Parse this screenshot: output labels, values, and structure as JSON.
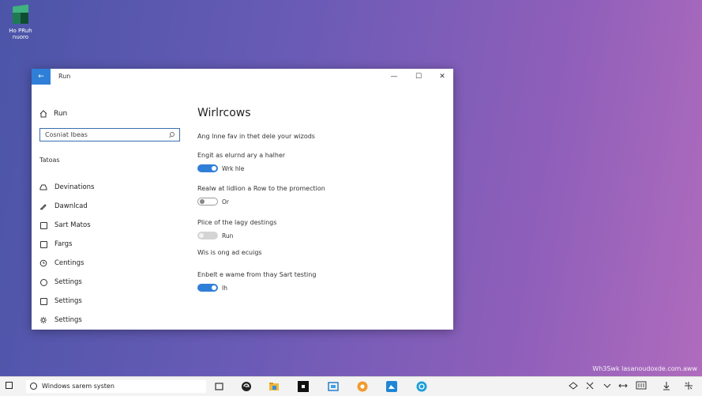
{
  "desktop": {
    "icon_label": "Ho PRuh nuoro"
  },
  "window": {
    "title": "Run",
    "back_glyph": "←",
    "controls": {
      "minimize": "—",
      "maximize": "☐",
      "close": "✕"
    }
  },
  "sidebar": {
    "home_label": "Run",
    "search_value": "Cosniat Ibeas",
    "section": "Tatoas",
    "items": [
      {
        "label": "Devinations",
        "icon": "hdd-icon"
      },
      {
        "label": "Dawnlcad",
        "icon": "pen-icon"
      },
      {
        "label": "Sart Matos",
        "icon": "square-icon"
      },
      {
        "label": "Fargs",
        "icon": "square-icon"
      },
      {
        "label": "Centings",
        "icon": "clock-icon"
      },
      {
        "label": "Settings",
        "icon": "circle-icon"
      },
      {
        "label": "Settings",
        "icon": "square-icon"
      },
      {
        "label": "Settings",
        "icon": "gear-icon"
      }
    ]
  },
  "content": {
    "title": "Wirlrcows",
    "description": "Ang lnne fav in thet dele your wizods",
    "settings": [
      {
        "label": "Engit as elurnd ary a halher",
        "state": "on",
        "toggle_text": "Wrk hle"
      },
      {
        "label": "Realw at lidlion a Row to the promection",
        "state": "off",
        "toggle_text": "Or"
      },
      {
        "label": "Plice of the lagy destings",
        "state": "disabled",
        "toggle_text": "Run"
      },
      {
        "label": "Wis is ong ad ecuigs",
        "state": "none",
        "toggle_text": ""
      },
      {
        "label": "Enbelt e wame from thay Sart testing",
        "state": "on",
        "toggle_text": "Ih"
      }
    ]
  },
  "watermark": "Wh3Swk lasanoudoxde.com.aww",
  "taskbar": {
    "search_text": "Windows sarem systen",
    "apps": [
      "edge-icon",
      "file-explorer-icon",
      "terminal-icon",
      "store-icon",
      "chrome-icon",
      "photos-icon",
      "browser-icon"
    ],
    "tray": [
      "network-icon",
      "sync-icon",
      "chevron-icon",
      "arrows-icon",
      "display-icon",
      "download-icon",
      "expand-icon"
    ]
  },
  "colors": {
    "accent": "#2f7fd8"
  }
}
